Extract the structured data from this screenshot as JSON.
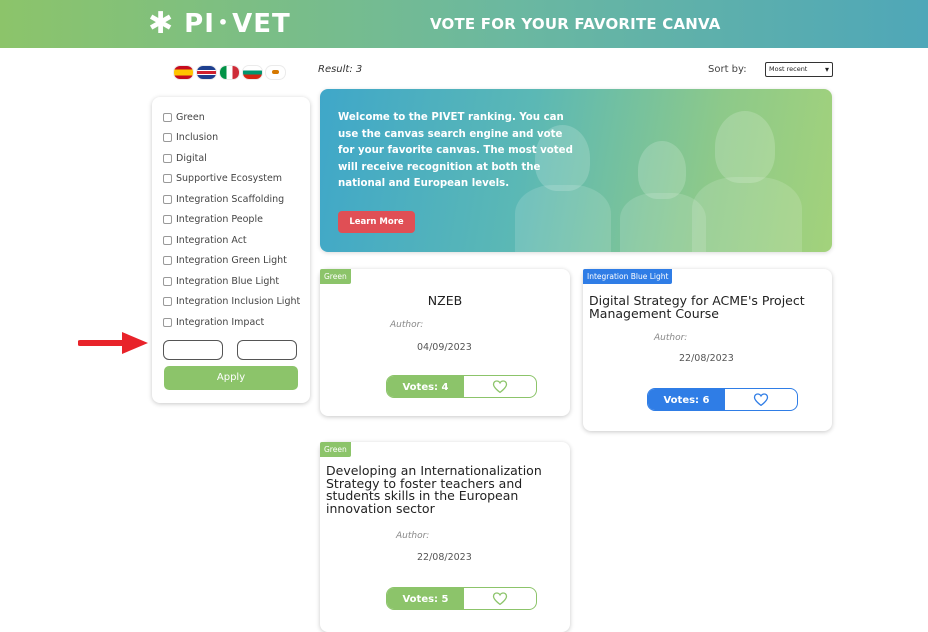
{
  "header": {
    "logo_text": "PI",
    "logo_text_2": "VET",
    "logo_asterisk": "✱",
    "logo_dot": "•",
    "title": "VOTE FOR YOUR FAVORITE CANVA",
    "gradient": [
      "#8cc46a",
      "#4fa7b8"
    ]
  },
  "languages": [
    "es",
    "gb",
    "it",
    "bg",
    "cy"
  ],
  "filters": {
    "items": [
      "Green",
      "Inclusion",
      "Digital",
      "Supportive Ecosystem",
      "Integration Scaffolding",
      "Integration People",
      "Integration Act",
      "Integration Green Light",
      "Integration Blue Light",
      "Integration Inclusion Light",
      "Integration Impact"
    ],
    "range_from_value": "",
    "range_to_value": "",
    "apply_label": "Apply"
  },
  "results": {
    "label": "Result: 3",
    "sort_label": "Sort by:",
    "sort_value": "Most recent",
    "sort_caret": "▾"
  },
  "banner": {
    "text": "Welcome to the PIVET ranking. You can use the canvas search engine and vote for your favorite canvas. The most voted will receive recognition at both the national and European levels.",
    "button_label": "Learn More"
  },
  "cards": [
    {
      "tag": "Green",
      "title": "NZEB",
      "author_label": "Author:",
      "date": "04/09/2023",
      "votes_label": "Votes: 4"
    },
    {
      "tag": "Integration Blue Light",
      "title": "Digital Strategy for ACME's Project Management Course",
      "author_label": "Author:",
      "date": "22/08/2023",
      "votes_label": "Votes: 6"
    },
    {
      "tag": "Green",
      "title": "Developing an Internationalization Strategy to foster teachers and students skills in the European innovation sector",
      "author_label": "Author:",
      "date": "22/08/2023",
      "votes_label": "Votes: 5"
    }
  ],
  "colors": {
    "green": "#8cc46a",
    "blue": "#2f7de6",
    "red_button": "#e04f55",
    "arrow": "#e8232a"
  }
}
